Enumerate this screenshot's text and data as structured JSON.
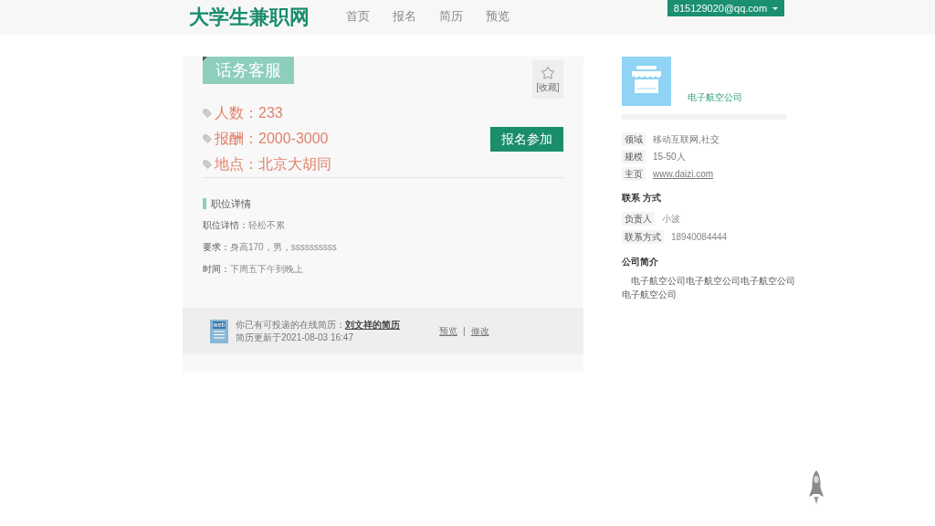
{
  "header": {
    "logo": "大学生兼职网",
    "nav": [
      "首页",
      "报名",
      "简历",
      "预览"
    ],
    "user_menu": "815129020@qq.com"
  },
  "job": {
    "title": "话务客服",
    "favorite_label": "[收藏]",
    "facts": [
      "人数：233",
      "报酬：2000-3000",
      "地点：北京大胡同"
    ],
    "apply_button": "报名参加",
    "details": {
      "heading": "职位详情",
      "rows": [
        {
          "label": "职位详情：",
          "value": "轻松不累"
        },
        {
          "label": "要求：",
          "value": "身高170，男，ssssssssss"
        },
        {
          "label": "时间：",
          "value": "下周五下午到晚上"
        }
      ]
    },
    "resume": {
      "icon_label": "web",
      "prompt": "你已有可投递的在线简历：",
      "link": "刘文祥的简历",
      "updated": "简历更新于2021-08-03 16:47",
      "actions": [
        "预览",
        "修改"
      ],
      "separator": "|"
    }
  },
  "company": {
    "name": "电子航空公司",
    "info": [
      {
        "kind": "text",
        "label": "领域",
        "value": "移动互联网,社交"
      },
      {
        "kind": "text",
        "label": "规模",
        "value": "15-50人"
      },
      {
        "kind": "link",
        "label": "主页",
        "value": "www.daizi.com"
      }
    ],
    "contact_heading": "联系 方式",
    "contacts": [
      {
        "label": "负责人",
        "value": "小波"
      },
      {
        "label": "联系方式",
        "value": "18940084444"
      }
    ],
    "intro_heading": "公司简介",
    "intro": "电子航空公司电子航空公司电子航空公司电子航空公司"
  }
}
